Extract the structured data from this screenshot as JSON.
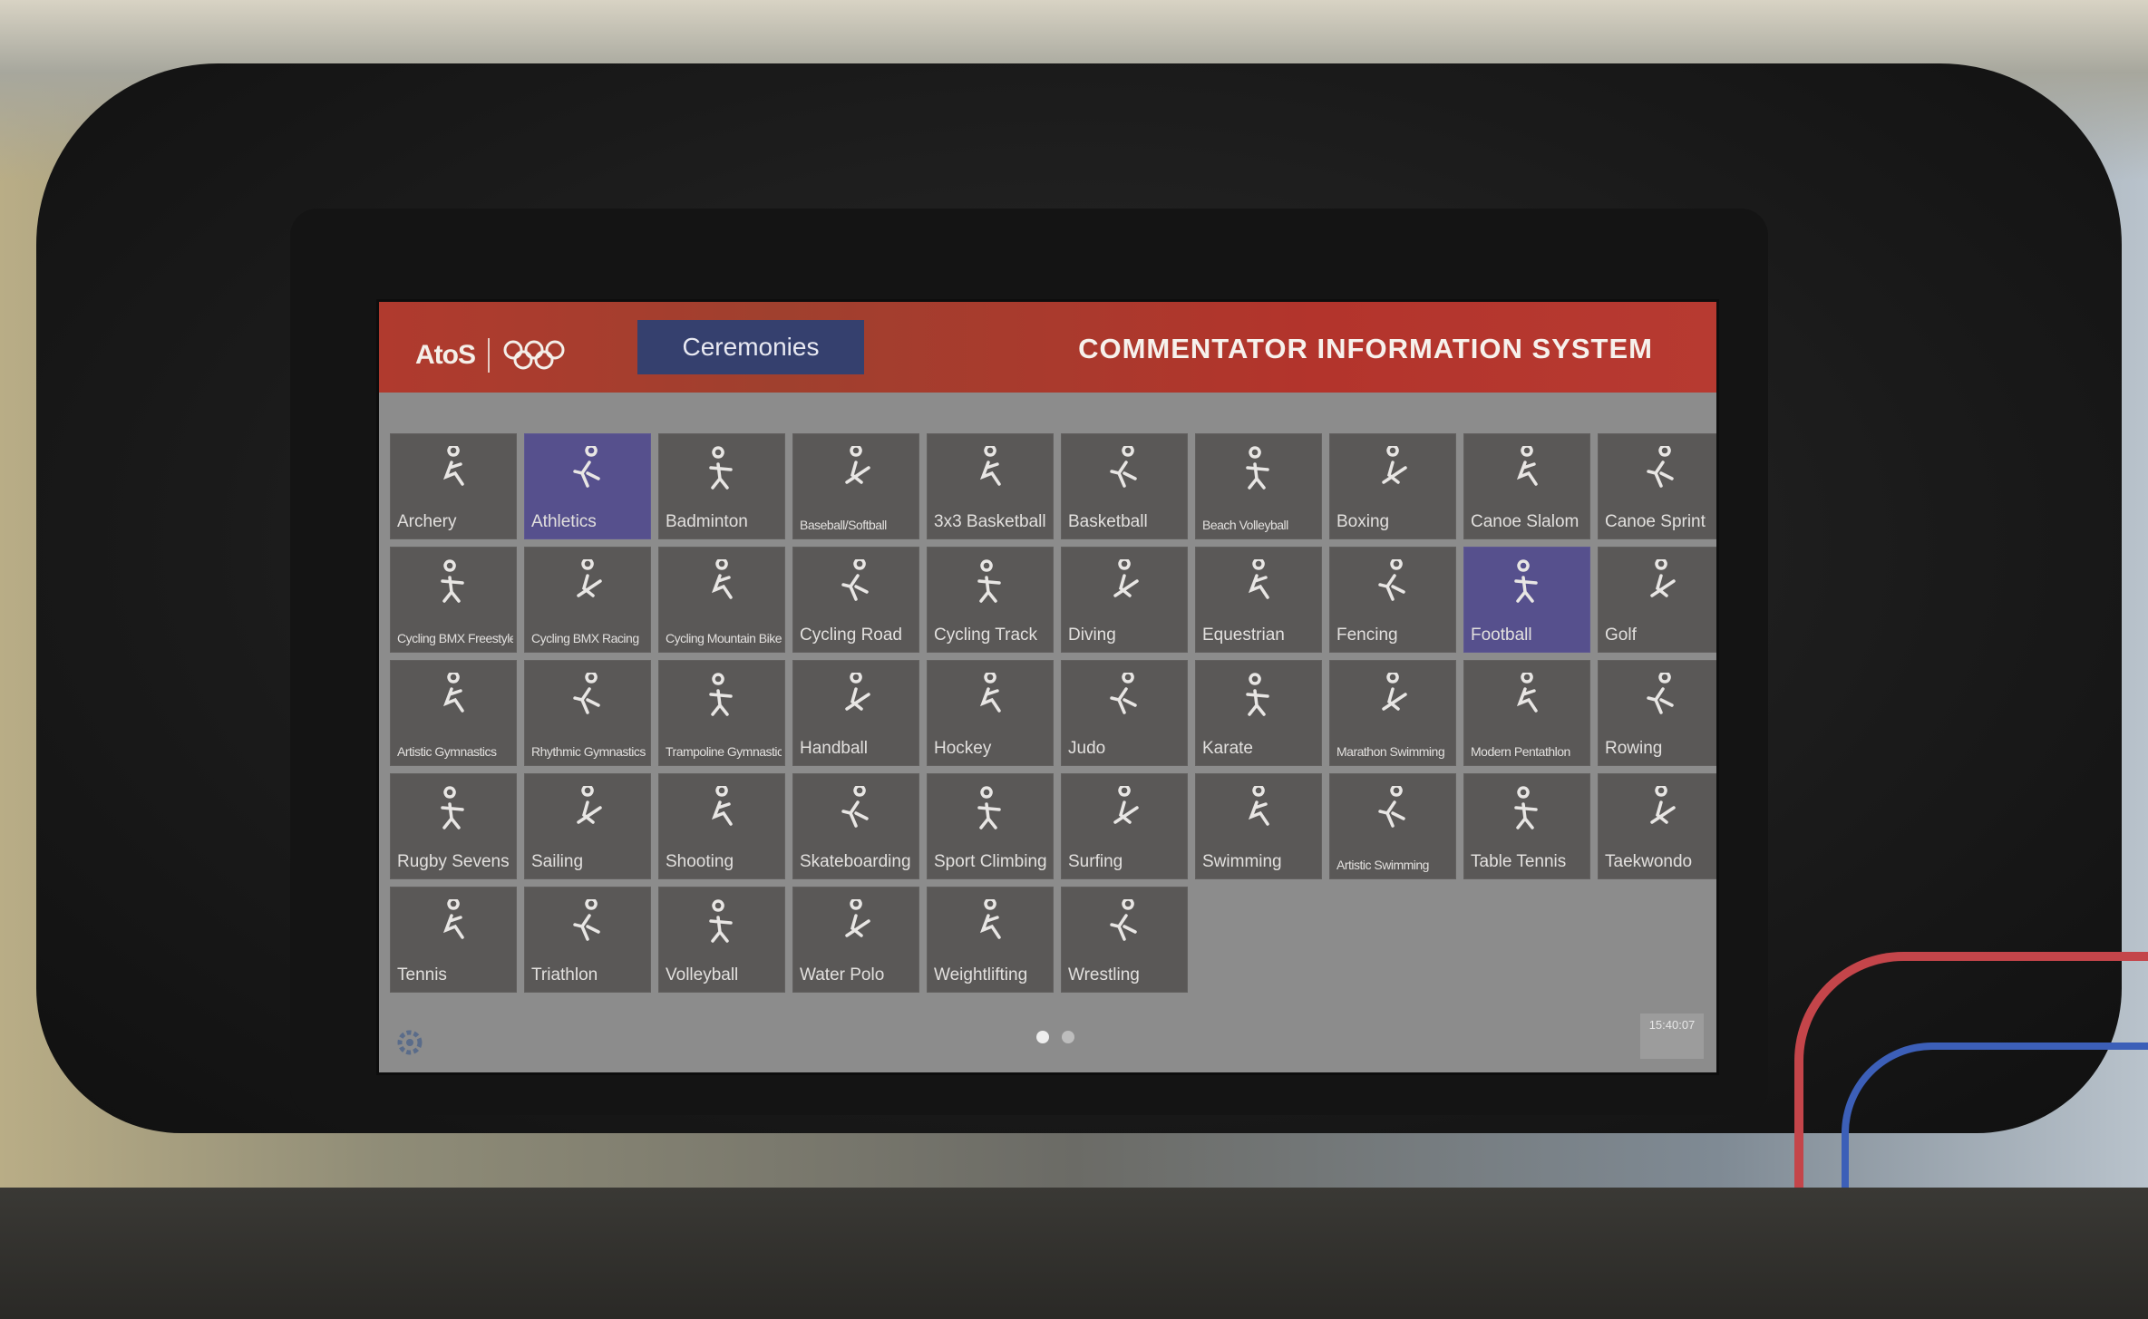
{
  "header": {
    "logo_text": "AtoS",
    "tab_label": "Ceremonies",
    "title": "COMMENTATOR INFORMATION SYSTEM"
  },
  "colors": {
    "topbar": "#b03a2e",
    "tab": "#35406e",
    "tile": "#5a5857",
    "tile_selected": "#56508d"
  },
  "sports": [
    {
      "label": "Archery",
      "icon": "archery-icon"
    },
    {
      "label": "Athletics",
      "icon": "athletics-icon",
      "selected": true
    },
    {
      "label": "Badminton",
      "icon": "badminton-icon"
    },
    {
      "label": "Baseball/Softball",
      "icon": "baseball-icon"
    },
    {
      "label": "3x3 Basketball",
      "icon": "basketball-3x3-icon"
    },
    {
      "label": "Basketball",
      "icon": "basketball-icon"
    },
    {
      "label": "Beach Volleyball",
      "icon": "beach-volleyball-icon"
    },
    {
      "label": "Boxing",
      "icon": "boxing-icon"
    },
    {
      "label": "Canoe Slalom",
      "icon": "canoe-slalom-icon"
    },
    {
      "label": "Canoe Sprint",
      "icon": "canoe-sprint-icon"
    },
    {
      "label": "Cycling BMX Freestyle",
      "icon": "bmx-freestyle-icon"
    },
    {
      "label": "Cycling BMX Racing",
      "icon": "bmx-racing-icon"
    },
    {
      "label": "Cycling Mountain Bike",
      "icon": "mountain-bike-icon"
    },
    {
      "label": "Cycling Road",
      "icon": "cycling-road-icon"
    },
    {
      "label": "Cycling Track",
      "icon": "cycling-track-icon"
    },
    {
      "label": "Diving",
      "icon": "diving-icon"
    },
    {
      "label": "Equestrian",
      "icon": "equestrian-icon"
    },
    {
      "label": "Fencing",
      "icon": "fencing-icon"
    },
    {
      "label": "Football",
      "icon": "football-icon",
      "selected": true
    },
    {
      "label": "Golf",
      "icon": "golf-icon"
    },
    {
      "label": "Artistic Gymnastics",
      "icon": "artistic-gymnastics-icon"
    },
    {
      "label": "Rhythmic Gymnastics",
      "icon": "rhythmic-gymnastics-icon"
    },
    {
      "label": "Trampoline Gymnastics",
      "icon": "trampoline-icon"
    },
    {
      "label": "Handball",
      "icon": "handball-icon"
    },
    {
      "label": "Hockey",
      "icon": "hockey-icon"
    },
    {
      "label": "Judo",
      "icon": "judo-icon"
    },
    {
      "label": "Karate",
      "icon": "karate-icon"
    },
    {
      "label": "Marathon Swimming",
      "icon": "marathon-swimming-icon"
    },
    {
      "label": "Modern Pentathlon",
      "icon": "modern-pentathlon-icon"
    },
    {
      "label": "Rowing",
      "icon": "rowing-icon"
    },
    {
      "label": "Rugby Sevens",
      "icon": "rugby-icon"
    },
    {
      "label": "Sailing",
      "icon": "sailing-icon"
    },
    {
      "label": "Shooting",
      "icon": "shooting-icon"
    },
    {
      "label": "Skateboarding",
      "icon": "skateboarding-icon"
    },
    {
      "label": "Sport Climbing",
      "icon": "sport-climbing-icon"
    },
    {
      "label": "Surfing",
      "icon": "surfing-icon"
    },
    {
      "label": "Swimming",
      "icon": "swimming-icon"
    },
    {
      "label": "Artistic Swimming",
      "icon": "artistic-swimming-icon"
    },
    {
      "label": "Table Tennis",
      "icon": "table-tennis-icon"
    },
    {
      "label": "Taekwondo",
      "icon": "taekwondo-icon"
    },
    {
      "label": "Tennis",
      "icon": "tennis-icon"
    },
    {
      "label": "Triathlon",
      "icon": "triathlon-icon"
    },
    {
      "label": "Volleyball",
      "icon": "volleyball-icon"
    },
    {
      "label": "Water Polo",
      "icon": "water-polo-icon"
    },
    {
      "label": "Weightlifting",
      "icon": "weightlifting-icon"
    },
    {
      "label": "Wrestling",
      "icon": "wrestling-icon"
    }
  ],
  "pagination": {
    "pages": 2,
    "current": 1
  },
  "footer": {
    "settings_icon": "gear-icon",
    "clock_time": "15:40:07"
  }
}
